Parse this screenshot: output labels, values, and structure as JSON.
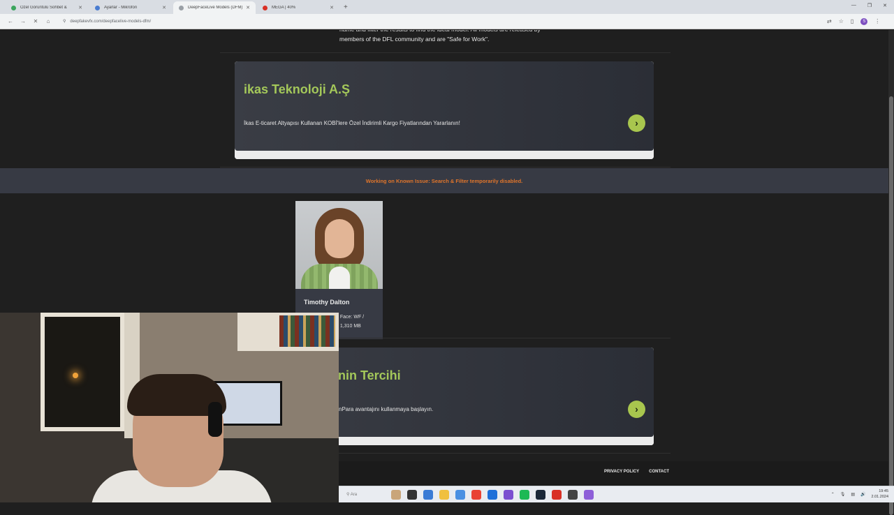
{
  "browser": {
    "tabs": [
      {
        "label": "Özel Görüntülü Sohbet &",
        "active": false,
        "color": "#3ba55d"
      },
      {
        "label": "Ayarlar - Mikrofon",
        "active": false,
        "color": "#4a7dd0"
      },
      {
        "label": "DeepFaceLive Models (DFM)",
        "active": true,
        "color": "#9aa0a6"
      },
      {
        "label": "MEGA | 40%",
        "active": false,
        "color": "#d93025"
      }
    ],
    "new_tab": "+",
    "url": "deepfakevfx.com/deepfacelive-models-dfm/",
    "profile_initial": "S"
  },
  "page": {
    "intro_text": "name and filter the results to find the ideal model! All models are released by members of the DFL community and are \"Safe for Work\".",
    "ad1": {
      "title": "ikas Teknoloji A.Ş",
      "description": "İkas E-ticaret Altyapısı Kullanan KOBİ'lere Özel İndirimli Kargo Fiyatlarından Yararlanın!"
    },
    "notice": "Working on Known Issue: Search & Filter temporarily disabled.",
    "model_card": {
      "name": "Timothy Dalton",
      "meta_line1": "/ Face: WF /",
      "meta_line2": ": 1,310 MB"
    },
    "ad2": {
      "title": "nin Tercihi",
      "description": "nPara avantajını kullanmaya başlayın."
    },
    "footer": {
      "privacy": "PRIVACY POLICY",
      "contact": "CONTACT"
    }
  },
  "taskbar": {
    "search_placeholder": "Ara",
    "clock_time": "19:45",
    "clock_date": "2.01.2024"
  }
}
